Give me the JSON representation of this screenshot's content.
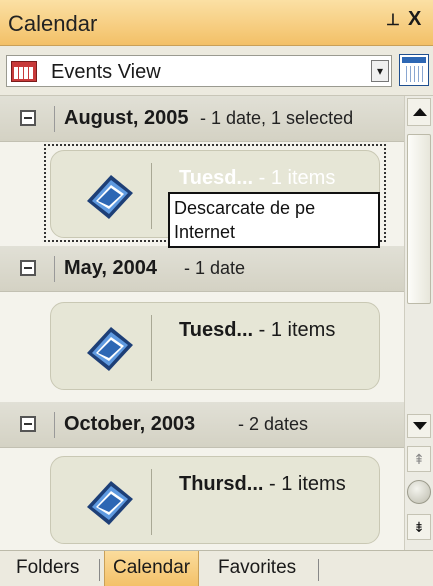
{
  "window": {
    "title": "Calendar",
    "pin_glyph": "⊥",
    "close_glyph": "X"
  },
  "view": {
    "selected": "Events View",
    "dropdown_glyph": "▾"
  },
  "groups": [
    {
      "title": "August, 2005",
      "detail": "- 1 date, 1 selected",
      "card": {
        "name": "Tuesd...",
        "detail": "- 1 items",
        "selected": true
      }
    },
    {
      "title": "May, 2004",
      "detail": "- 1 date",
      "card": {
        "name": "Tuesd...",
        "detail": "- 1 items",
        "selected": false
      }
    },
    {
      "title": "October, 2003",
      "detail": "- 2 dates",
      "card": {
        "name": "Thursd...",
        "detail": "- 1 items",
        "selected": false
      }
    }
  ],
  "tooltip": {
    "line1": "Descarcate de pe",
    "line2": "Internet"
  },
  "scrollbar": {
    "page_up_glyph": "⇞",
    "page_down_glyph": "⇟"
  },
  "tabs": [
    {
      "label": "Folders",
      "active": false
    },
    {
      "label": "Calendar",
      "active": true
    },
    {
      "label": "Favorites",
      "active": false
    }
  ],
  "colors": {
    "accent": "#f3c067",
    "panel": "#f4f3ec",
    "card": "#e6e6d6",
    "icon_blue": "#2d67b4"
  },
  "icons": [
    "calendar-view-icon",
    "calendar-icon",
    "event-item-icon",
    "collapse-icon"
  ]
}
